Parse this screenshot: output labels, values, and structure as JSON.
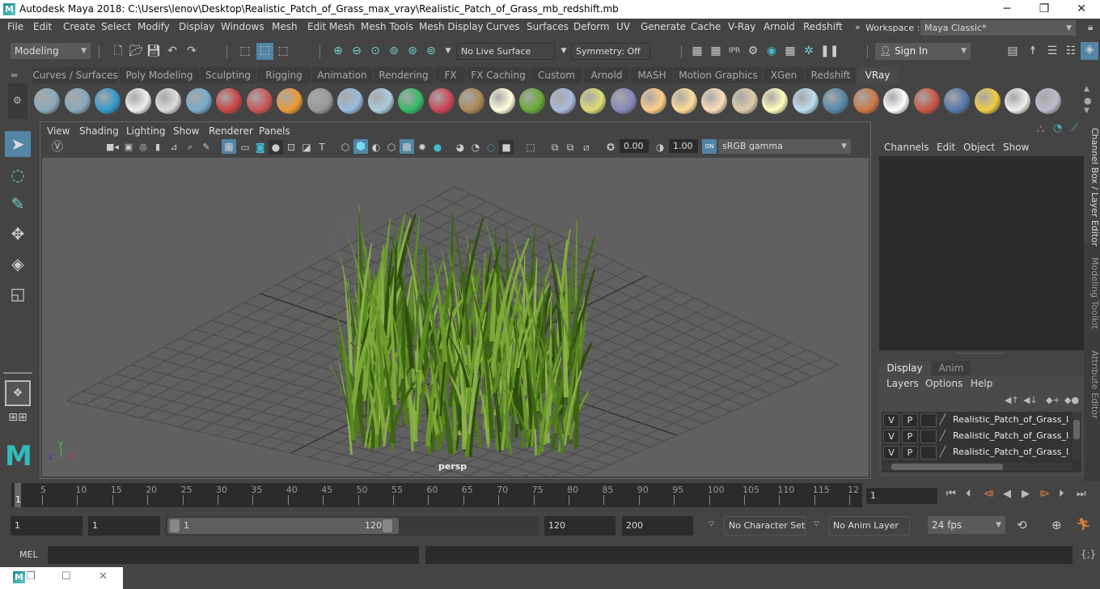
{
  "window": {
    "title": "Autodesk Maya 2018: C:\\Users\\lenov\\Desktop\\Realistic_Patch_of_Grass_max_vray\\Realistic_Patch_of_Grass_mb_redshift.mb",
    "logo_letter": "M",
    "minimize": "─",
    "maximize": "❐",
    "close": "✕"
  },
  "menubar": {
    "items": [
      "File",
      "Edit",
      "Create",
      "Select",
      "Modify",
      "Display",
      "Windows",
      "Mesh",
      "Edit Mesh",
      "Mesh Tools",
      "Mesh Display",
      "Curves",
      "Surfaces",
      "Deform",
      "UV",
      "Generate",
      "Cache",
      "V-Ray",
      "Arnold",
      "Redshift"
    ],
    "overflow": "»",
    "workspace_label": "Workspace :",
    "workspace_value": "Maya Classic*"
  },
  "statusline": {
    "menuset": "Modeling",
    "live_surface": "No Live Surface",
    "symmetry": "Symmetry: Off",
    "sign_in": "Sign In"
  },
  "shelf": {
    "tabs": [
      "Curves / Surfaces",
      "Poly Modeling",
      "Sculpting",
      "Rigging",
      "Animation",
      "Rendering",
      "FX",
      "FX Caching",
      "Custom",
      "Arnold",
      "MASH",
      "Motion Graphics",
      "XGen",
      "Redshift",
      "VRay"
    ],
    "active_tab": "VRay",
    "icons": [
      "vray-export-icon",
      "vray-import-icon",
      "vray-scene-list-icon",
      "vray-logo-icon",
      "vray-file-icon",
      "vray-dome-icon",
      "vray-camera-icon",
      "vray-molecule-icon",
      "vray-fire-icon",
      "vray-mesh-export-icon",
      "vray-proxy-icon",
      "vray-shapes-icon",
      "vray-light-volume-icon",
      "vray-material-icon",
      "vray-texture-icon",
      "vray-sphere-grid-icon",
      "vray-grass-icon",
      "vray-fur-icon",
      "vray-curve-icon",
      "vray-globe-icon",
      "vray-dome-light-icon",
      "vray-spot-light-icon",
      "vray-sphere-light-icon",
      "vray-ies-light-icon",
      "vray-sun-icon",
      "vray-plane-icon",
      "vray-blue-sphere-icon",
      "vray-striped-sphere-icon",
      "vray-checker-icon",
      "vray-frame-buffer-icon",
      "vray-settings-icon",
      "vray-light-lister-icon",
      "vray-cloud-icon",
      "vray-help-icon"
    ]
  },
  "viewport": {
    "menu": [
      "View",
      "Shading",
      "Lighting",
      "Show",
      "Renderer",
      "Panels"
    ],
    "exposure": "0.00",
    "gamma": "1.00",
    "color_mgmt_badge": "ON",
    "color_space": "sRGB gamma",
    "camera_label": "persp",
    "axis_labels": {
      "x": "x",
      "y": "y",
      "z": "z"
    }
  },
  "channelbox": {
    "menu": [
      "Channels",
      "Edit",
      "Object",
      "Show"
    ]
  },
  "layer_editor": {
    "tabs": [
      "Display",
      "Anim"
    ],
    "active_tab": "Display",
    "menu": [
      "Layers",
      "Options",
      "Help"
    ],
    "layers": [
      {
        "v": "V",
        "p": "P",
        "name": "Realistic_Patch_of_Grass_lay"
      },
      {
        "v": "V",
        "p": "P",
        "name": "Realistic_Patch_of_Grass_lay"
      },
      {
        "v": "V",
        "p": "P",
        "name": "Realistic_Patch_of_Grass_lay"
      }
    ]
  },
  "side_tabs": [
    "Channel Box / Layer Editor",
    "Modeling Toolkit",
    "Attribute Editor"
  ],
  "timeline": {
    "tick_labels": [
      "5",
      "10",
      "15",
      "20",
      "25",
      "30",
      "35",
      "40",
      "45",
      "50",
      "55",
      "60",
      "65",
      "70",
      "75",
      "80",
      "85",
      "90",
      "95",
      "100",
      "105",
      "110",
      "115",
      "12"
    ],
    "current_frame_marker": "1",
    "current_frame": "1"
  },
  "range": {
    "start": "1",
    "playback_start": "1",
    "slider_min_label": "1",
    "slider_max_label": "120",
    "playback_end": "120",
    "end": "200",
    "character_set": "No Character Set",
    "anim_layer": "No Anim Layer",
    "fps": "24 fps"
  },
  "cmdline": {
    "language": "MEL"
  },
  "colors": {
    "accent_blue": "#5285a6",
    "playhead_orange": "#d97a3a",
    "grass_green": "#5d8a22"
  }
}
